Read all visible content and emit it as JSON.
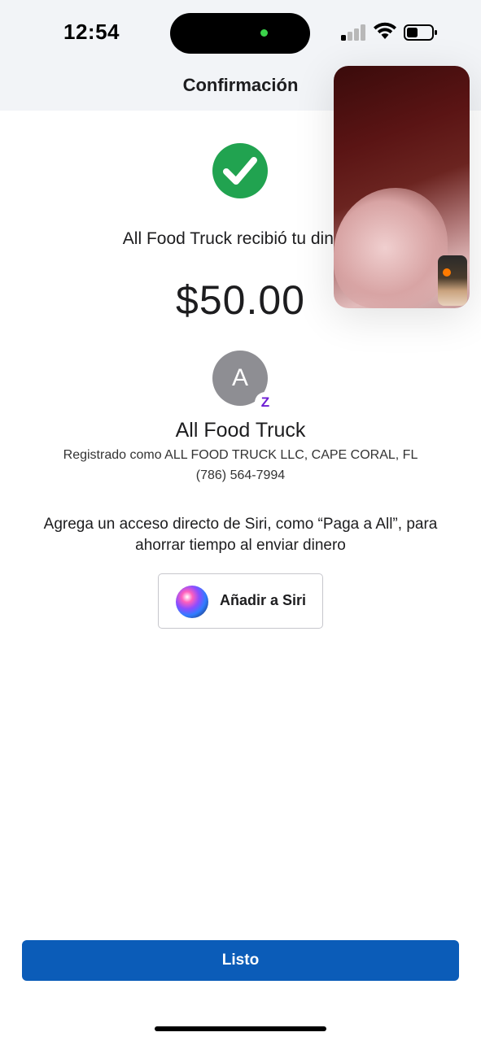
{
  "status_bar": {
    "time": "12:54",
    "icons": [
      "cellular-signal-icon",
      "wifi-icon",
      "battery-icon"
    ]
  },
  "header": {
    "title": "Confirmación"
  },
  "confirmation": {
    "icon": "checkmark-icon",
    "received_text": "All Food Truck recibió tu dinero",
    "amount": "$50.00"
  },
  "recipient": {
    "avatar_initial": "A",
    "badge_symbol": "Z",
    "name": "All Food Truck",
    "registered_as": "Registrado como ALL FOOD TRUCK LLC, CAPE CORAL, FL",
    "phone": "(786) 564-7994"
  },
  "siri": {
    "prompt": "Agrega un acceso directo de Siri, como “Paga a All”, para ahorrar tiempo al enviar dinero",
    "button_label": "Añadir a Siri",
    "icon": "siri-icon"
  },
  "footer": {
    "done_label": "Listo"
  },
  "colors": {
    "success_green": "#21a350",
    "primary_blue": "#0b5cb8",
    "zelle_purple": "#6d1ed4",
    "avatar_gray": "#8e8e93"
  }
}
